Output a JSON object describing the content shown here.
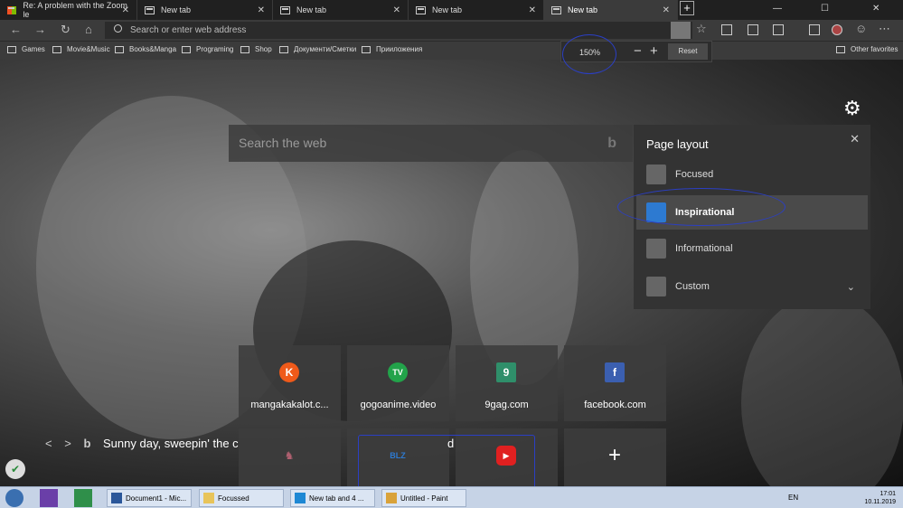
{
  "tabs": [
    {
      "label": "Re: A problem with the Zoom le",
      "icon": "microsoft-icon",
      "active": false
    },
    {
      "label": "New tab",
      "icon": "page-icon",
      "active": false
    },
    {
      "label": "New tab",
      "icon": "page-icon",
      "active": false
    },
    {
      "label": "New tab",
      "icon": "page-icon",
      "active": false
    },
    {
      "label": "New tab",
      "icon": "page-icon",
      "active": true
    }
  ],
  "address": {
    "placeholder": "Search or enter web address"
  },
  "bookmarks": [
    "Games",
    "Movie&Music",
    "Books&Manga",
    "Programing",
    "Shop",
    "Документи/Сметки",
    "Прииложения"
  ],
  "other_favorites": "Other favorites",
  "zoom": {
    "percent": "150%",
    "minus": "−",
    "plus": "+",
    "reset": "Reset"
  },
  "search": {
    "placeholder": "Search the web",
    "bing_glyph": "b"
  },
  "layout_panel": {
    "title": "Page layout",
    "close": "✕",
    "options": [
      {
        "label": "Focused",
        "selected": false
      },
      {
        "label": "Inspirational",
        "selected": true
      },
      {
        "label": "Informational",
        "selected": false
      },
      {
        "label": "Custom",
        "selected": false
      }
    ]
  },
  "tiles": [
    {
      "label": "mangakakalot.c...",
      "glyph": "K",
      "color": "#ef5a1a"
    },
    {
      "label": "gogoanime.video",
      "glyph": "TV",
      "color": "#22a34a"
    },
    {
      "label": "9gag.com",
      "glyph": "9",
      "color": "#2f8f6a"
    },
    {
      "label": "facebook.com",
      "glyph": "f",
      "color": "#3b5fb0"
    },
    {
      "label": "",
      "glyph": "♞",
      "color": "#8a5a70"
    },
    {
      "label": "",
      "glyph": "BLZ",
      "color": "#1d5fa8"
    },
    {
      "label": "",
      "glyph": "▶",
      "color": "#e02020"
    },
    {
      "label": "",
      "glyph": "+",
      "color": "transparent"
    }
  ],
  "news": {
    "headline_start": "Sunny day, sweepin' the c",
    "headline_end": "d",
    "bing": "b"
  },
  "taskbar": {
    "items": [
      "Document1 - Mic...",
      "Focussed",
      "New tab and 4 ...",
      "Untitled - Paint"
    ],
    "lang": "EN",
    "time": "17:01",
    "date": "10.11.2019"
  },
  "colors": {
    "annotation": "#2b3fc4",
    "accent": "#2d7ad1"
  }
}
